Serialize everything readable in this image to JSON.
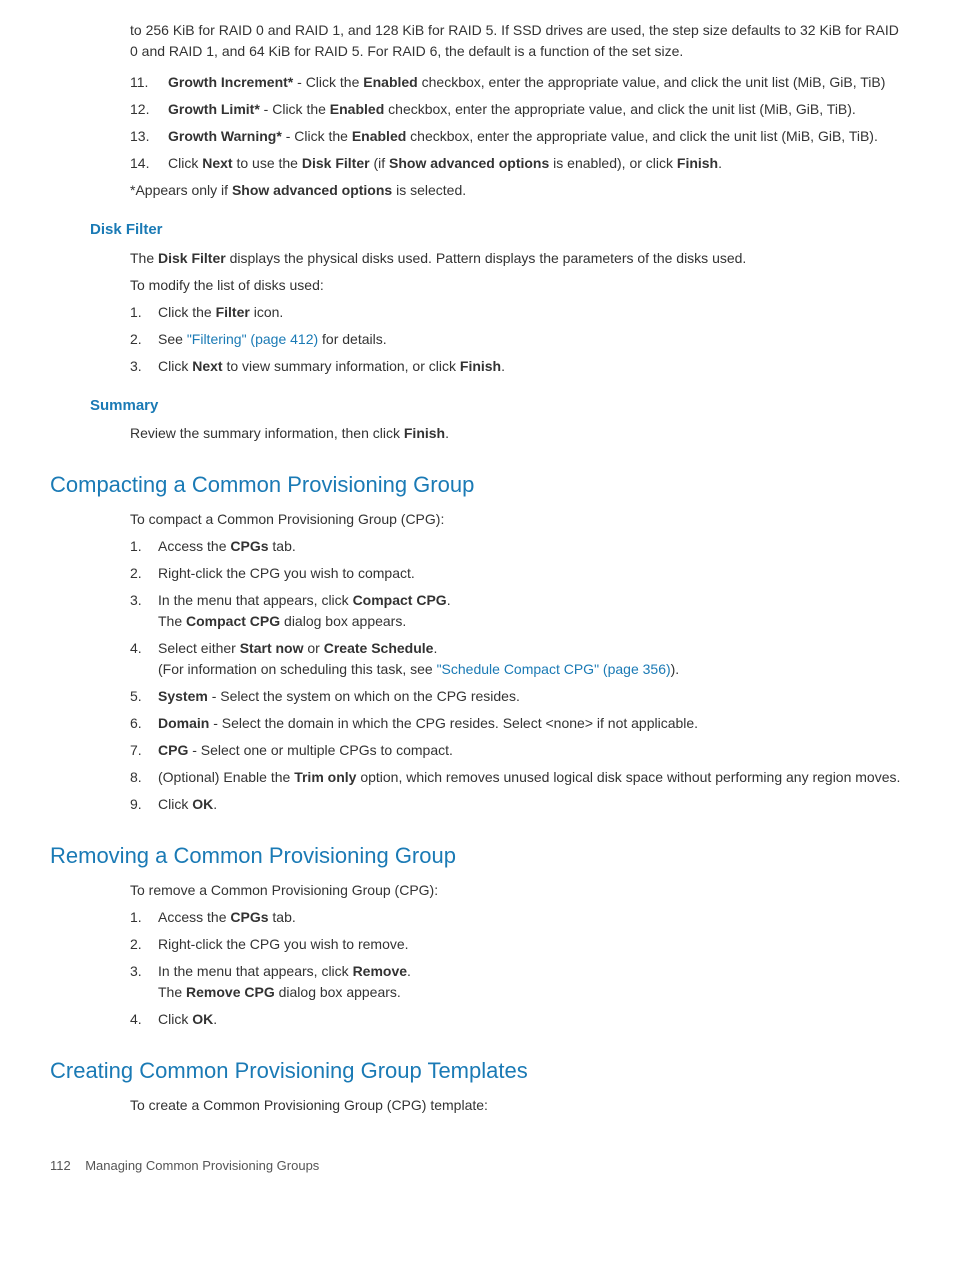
{
  "intro": {
    "para": "to 256 KiB for RAID 0 and RAID 1, and 128 KiB for RAID 5. If SSD drives are used, the step size defaults to 32 KiB for RAID 0 and RAID 1, and 64 KiB for RAID 5. For RAID 6, the default is a function of the set size."
  },
  "initial_list": [
    {
      "num": "11.",
      "text_before": "",
      "bold": "Growth Increment*",
      "text_after": " - Click the ",
      "bold2": "Enabled",
      "text_end": " checkbox, enter the appropriate value, and click the unit list (MiB, GiB, TiB)"
    },
    {
      "num": "12.",
      "text_before": "",
      "bold": "Growth Limit*",
      "text_after": " - Click the ",
      "bold2": "Enabled",
      "text_end": " checkbox, enter the appropriate value, and click the unit list (MiB, GiB, TiB)."
    },
    {
      "num": "13.",
      "text_before": "",
      "bold": "Growth Warning*",
      "text_after": " - Click the ",
      "bold2": "Enabled",
      "text_end": " checkbox, enter the appropriate value, and click the unit list (MiB, GiB, TiB)."
    },
    {
      "num": "14.",
      "text_before": "Click ",
      "bold": "Next",
      "text_after": " to use the ",
      "bold2": "Disk Filter",
      "text_end": " (if ",
      "bold3": "Show advanced options",
      "text_end2": " is enabled), or click ",
      "bold4": "Finish",
      "text_end3": "."
    }
  ],
  "note": "*Appears only if ",
  "note_bold": "Show advanced options",
  "note_end": " is selected.",
  "disk_filter": {
    "heading": "Disk Filter",
    "para": "The ",
    "bold": "Disk Filter",
    "para2": " displays the physical disks used. Pattern displays the parameters of the disks used.",
    "para3": "To modify the list of disks used:",
    "items": [
      {
        "num": "1.",
        "text": "Click the ",
        "bold": "Filter",
        "text_end": " icon."
      },
      {
        "num": "2.",
        "text": "See ",
        "link": "\"Filtering\" (page 412)",
        "text_end": " for details."
      },
      {
        "num": "3.",
        "text": "Click ",
        "bold": "Next",
        "text_mid": " to view summary information, or click ",
        "bold2": "Finish",
        "text_end": "."
      }
    ]
  },
  "summary": {
    "heading": "Summary",
    "para": "Review the summary information, then click ",
    "bold": "Finish",
    "para_end": "."
  },
  "compacting": {
    "heading": "Compacting a Common Provisioning Group",
    "intro": "To compact a Common Provisioning Group (CPG):",
    "items": [
      {
        "num": "1.",
        "text": "Access the ",
        "bold": "CPGs",
        "text_end": " tab."
      },
      {
        "num": "2.",
        "text": "Right-click the CPG you wish to compact."
      },
      {
        "num": "3.",
        "text": "In the menu that appears, click ",
        "bold": "Compact CPG",
        "text_end": ".",
        "sub": "The ",
        "sub_bold": "Compact CPG",
        "sub_end": " dialog box appears."
      },
      {
        "num": "4.",
        "text": "Select either ",
        "bold": "Start now",
        "text_mid": " or ",
        "bold2": "Create Schedule",
        "text_end": ".",
        "sub": "(For information on scheduling this task, see ",
        "sub_link": "\"Schedule Compact CPG\" (page 356)",
        "sub_end": ")."
      },
      {
        "num": "5.",
        "bold": "System",
        "text": " - Select the system on which on the CPG resides."
      },
      {
        "num": "6.",
        "bold": "Domain",
        "text": " - Select the domain in which the CPG resides. Select <none> if not applicable."
      },
      {
        "num": "7.",
        "bold": "CPG",
        "text": " - Select one or multiple CPGs to compact."
      },
      {
        "num": "8.",
        "text": "(Optional) Enable the ",
        "bold": "Trim only",
        "text_end": " option, which removes unused logical disk space without performing any region moves."
      },
      {
        "num": "9.",
        "text": "Click ",
        "bold": "OK",
        "text_end": "."
      }
    ]
  },
  "removing": {
    "heading": "Removing a Common Provisioning Group",
    "intro": "To remove a Common Provisioning Group (CPG):",
    "items": [
      {
        "num": "1.",
        "text": "Access the ",
        "bold": "CPGs",
        "text_end": " tab."
      },
      {
        "num": "2.",
        "text": "Right-click the CPG you wish to remove."
      },
      {
        "num": "3.",
        "text": "In the menu that appears, click ",
        "bold": "Remove",
        "text_end": ".",
        "sub": "The ",
        "sub_bold": "Remove CPG",
        "sub_end": " dialog box appears."
      },
      {
        "num": "4.",
        "text": "Click ",
        "bold": "OK",
        "text_end": "."
      }
    ]
  },
  "creating": {
    "heading": "Creating Common Provisioning Group Templates",
    "intro": "To create a Common Provisioning Group (CPG) template:"
  },
  "footer": {
    "page_num": "112",
    "text": "Managing Common Provisioning Groups"
  }
}
